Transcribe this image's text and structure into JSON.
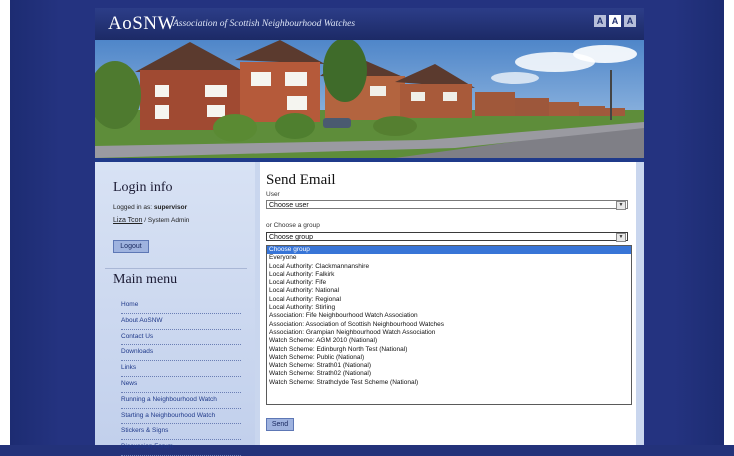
{
  "header": {
    "logo": "AoSNW",
    "tagline": "Association of Scottish Neighbourhood Watches",
    "text_size_buttons": [
      "A",
      "A",
      "A"
    ]
  },
  "sidebar": {
    "login_title": "Login info",
    "logged_in_prefix": "Logged in as:",
    "logged_in_user": "supervisor",
    "user_name": "Liza Tcon",
    "user_role": "/ System Admin",
    "logout_label": "Logout",
    "menu_title": "Main menu",
    "menu_items": [
      "Home",
      "About AoSNW",
      "Contact Us",
      "Downloads",
      "Links",
      "News",
      "Running a Neighbourhood Watch",
      "Starting a Neighbourhood Watch",
      "Stickers & Signs",
      "Discussion Forum"
    ]
  },
  "main": {
    "title": "Send Email",
    "user_label": "User",
    "user_select_value": "Choose user",
    "group_label": "or Choose a group",
    "group_select_value": "Choose group",
    "group_options": [
      "Choose group",
      "Everyone",
      "Local Authority: Clackmannanshire",
      "Local Authority: Falkirk",
      "Local Authority: Fife",
      "Local Authority: National",
      "Local Authority: Regional",
      "Local Authority: Stirling",
      "Association: Fife Neighbourhood Watch Association",
      "Association: Association of Scottish Neighbourhood Watches",
      "Association: Grampian Neighbourhood Watch Association",
      "Watch Scheme: AGM 2010 (National)",
      "Watch Scheme: Edinburgh North Test (National)",
      "Watch Scheme: Public (National)",
      "Watch Scheme: Strath01 (National)",
      "Watch Scheme: Strath02 (National)",
      "Watch Scheme: Strathclyde Test Scheme (National)"
    ],
    "send_label": "Send"
  },
  "colors": {
    "background": "#23327a",
    "header": "#1c2a66",
    "sidebar": "#c9d6ee",
    "selection": "#3875d7"
  }
}
